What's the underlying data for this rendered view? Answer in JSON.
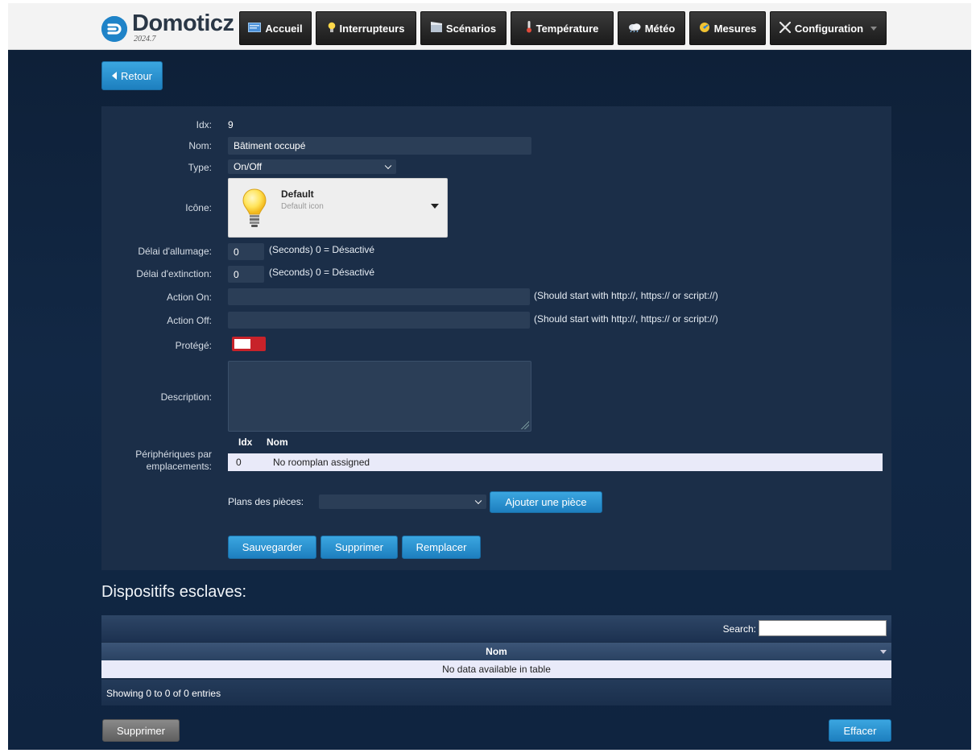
{
  "app": {
    "name": "Domoticz",
    "version": "2024.7"
  },
  "nav": {
    "items": [
      {
        "label": "Accueil",
        "icon": "home-icon"
      },
      {
        "label": "Interrupteurs",
        "icon": "lightbulb-icon"
      },
      {
        "label": "Scénarios",
        "icon": "clapperboard-icon"
      },
      {
        "label": "Température",
        "icon": "thermometer-icon"
      },
      {
        "label": "Météo",
        "icon": "weather-cloud-icon"
      },
      {
        "label": "Mesures",
        "icon": "gauge-icon"
      },
      {
        "label": "Configuration",
        "icon": "tools-icon"
      }
    ]
  },
  "back_button": {
    "label": "Retour",
    "icon": "caret-left-icon"
  },
  "form": {
    "idx_label": "Idx:",
    "idx_value": "9",
    "name_label": "Nom:",
    "name_value": "Bâtiment occupé",
    "type_label": "Type:",
    "type_value": "On/Off",
    "icon_label": "Icône:",
    "icon_title": "Default",
    "icon_desc": "Default icon",
    "on_delay_label": "Délai d'allumage:",
    "on_delay_value": "0",
    "on_delay_hint": "(Seconds) 0 = Désactivé",
    "off_delay_label": "Délai d'extinction:",
    "off_delay_value": "0",
    "off_delay_hint": "(Seconds) 0 = Désactivé",
    "action_on_label": "Action On:",
    "action_on_value": "",
    "action_on_hint": "(Should start with http://, https:// or script://)",
    "action_off_label": "Action Off:",
    "action_off_value": "",
    "action_off_hint": "(Should start with http://, https:// or script://)",
    "protected_label": "Protégé:",
    "protected_on": true,
    "description_label": "Description:",
    "description_value": "",
    "rooms_label_line1": "Périphériques par",
    "rooms_label_line2": "emplacements:",
    "rooms_table": {
      "headers": [
        "Idx",
        "Nom"
      ],
      "rows": [
        {
          "idx": "0",
          "name": "No roomplan assigned"
        }
      ]
    },
    "roomplans_label": "Plans des pièces:",
    "roomplans_value": "",
    "add_room_button": "Ajouter une pièce",
    "save_button": "Sauvegarder",
    "delete_button": "Supprimer",
    "replace_button": "Remplacer"
  },
  "slaves": {
    "title": "Dispositifs esclaves:",
    "search_label": "Search:",
    "search_value": "",
    "column_header": "Nom",
    "empty_text": "No data available in table",
    "info_text": "Showing 0 to 0 of 0 entries",
    "delete_button": "Supprimer",
    "clear_button": "Effacer"
  },
  "colors": {
    "accent_blue": "#1d7fbf",
    "panel_dark": "#1b2e48",
    "toggle_red": "#c8222a"
  }
}
